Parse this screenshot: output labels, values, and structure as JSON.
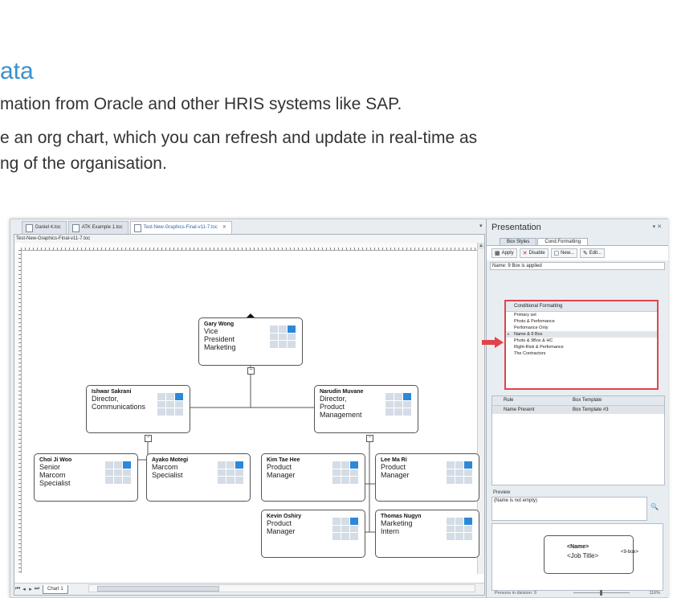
{
  "intro": {
    "heading": "ata",
    "line1": "mation from Oracle and other HRIS systems like SAP.",
    "line2": "e an org chart, which you can refresh and update in real-time as",
    "line3": "ng of the organisation."
  },
  "doc_tabs": [
    {
      "label": "Daniel 4.toc",
      "active": false
    },
    {
      "label": "ATK Example 1.toc",
      "active": false
    },
    {
      "label": "Test-New-Graphics-Final-v11-7.toc",
      "active": true
    }
  ],
  "document": {
    "name": "Test-New-Graphics-Final-v11-7.toc",
    "sheet_tab": "Chart 1",
    "cards": [
      {
        "id": "gary",
        "name": "Gary Wong",
        "title": [
          "Vice",
          "President",
          "Marketing"
        ]
      },
      {
        "id": "ishwar",
        "name": "Ishwar Sakrani",
        "title": [
          "Director,",
          "Communications"
        ]
      },
      {
        "id": "narudin",
        "name": "Narudin Muvane",
        "title": [
          "Director,",
          "Product",
          "Management"
        ]
      },
      {
        "id": "choi",
        "name": "Choi Ji Woo",
        "title": [
          "Senior",
          "Marcom",
          "Specialist"
        ]
      },
      {
        "id": "ayako",
        "name": "Ayako Motegi",
        "title": [
          "Marcom",
          "Specialist"
        ]
      },
      {
        "id": "kim",
        "name": "Kim Tae Hee",
        "title": [
          "Product",
          "Manager"
        ]
      },
      {
        "id": "lee",
        "name": "Lee Ma Ri",
        "title": [
          "Product",
          "Manager"
        ]
      },
      {
        "id": "kevin",
        "name": "Kevin Oshiry",
        "title": [
          "Product",
          "Manager"
        ]
      },
      {
        "id": "thomas",
        "name": "Thomas Nugyn",
        "title": [
          "Marketing",
          "Intern"
        ]
      }
    ]
  },
  "panel": {
    "title": "Presentation",
    "tabs": [
      "Box Styles",
      "Cond.Formatting"
    ],
    "toolbar": {
      "apply": "Apply",
      "disable": "Disable",
      "new": "New...",
      "edit": "Edit..."
    },
    "applied": "Name: 9 Box is applied",
    "cf_header": "Conditional Formatting",
    "cf_items": [
      {
        "label": "Primary set",
        "selected": false
      },
      {
        "label": "Photo & Perfomance",
        "selected": false
      },
      {
        "label": "Perfomance Only",
        "selected": false
      },
      {
        "label": "Name & 9 Box",
        "selected": true
      },
      {
        "label": "Photo & 9Box & HC",
        "selected": false
      },
      {
        "label": "Right-Risk & Perfomance",
        "selected": false
      },
      {
        "label": "The Contractors",
        "selected": false
      }
    ],
    "rules_header": {
      "rule": "Rule",
      "template": "Box Template"
    },
    "rules_rows": [
      {
        "rule": "Name Present",
        "template": "Box Template #3"
      }
    ],
    "preview_label": "Preview",
    "preview_value": "(Name is not empty)",
    "sample": {
      "name": "<Name>",
      "title": "<Job Title>",
      "box": "<9-box>"
    },
    "status": "Persons in division: 9",
    "zoom": "116%"
  },
  "colors": {
    "accent": "#3b8fd0",
    "highlight_red": "#e0444a",
    "ninebox_blue": "#2d88d8"
  }
}
